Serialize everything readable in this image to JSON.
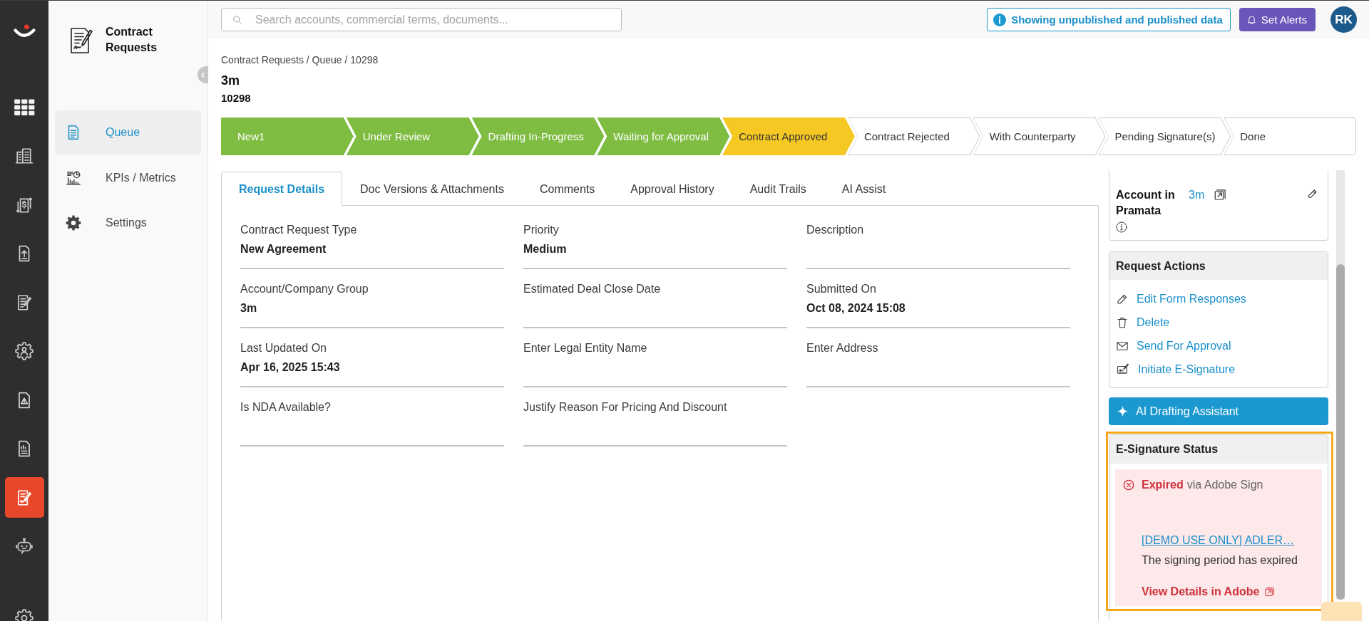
{
  "rail": {
    "items": [
      {
        "kind": "grid",
        "selected": false
      },
      {
        "kind": "buildings",
        "selected": false
      },
      {
        "kind": "dollar",
        "selected": false
      },
      {
        "kind": "upload",
        "selected": false
      },
      {
        "kind": "edit",
        "selected": false
      },
      {
        "kind": "cogperson",
        "selected": false
      },
      {
        "kind": "warning",
        "selected": false
      },
      {
        "kind": "report",
        "selected": false
      },
      {
        "kind": "signature",
        "selected": true
      },
      {
        "kind": "robot",
        "selected": false
      },
      {
        "kind": "cog",
        "selected": false
      }
    ]
  },
  "nav": {
    "title": "Contract Requests",
    "items": [
      {
        "kind": "document",
        "label": "Queue",
        "selected": true
      },
      {
        "kind": "chart",
        "label": "KPIs / Metrics",
        "selected": false
      },
      {
        "kind": "gear",
        "label": "Settings",
        "selected": false
      }
    ]
  },
  "top_bar": {
    "search": {
      "placeholder": "Search accounts, commercial terms, documents..."
    },
    "data_notice": "Showing unpublished and published data",
    "alerts_button": "Set Alerts",
    "avatar": "RK"
  },
  "header": {
    "breadcrumb": "Contract Requests / Queue / 10298",
    "title": "3m",
    "subtitle": "10298"
  },
  "stages": [
    {
      "label": "New1",
      "completed": true,
      "current": false
    },
    {
      "label": "Under Review",
      "completed": true,
      "current": false
    },
    {
      "label": "Drafting In-Progress",
      "completed": true,
      "current": false
    },
    {
      "label": "Waiting for Approval",
      "completed": true,
      "current": false
    },
    {
      "label": "Contract Approved",
      "completed": false,
      "current": true
    },
    {
      "label": "Contract Rejected",
      "completed": false,
      "current": false
    },
    {
      "label": "With Counterparty",
      "completed": false,
      "current": false
    },
    {
      "label": "Pending Signature(s)",
      "completed": false,
      "current": false
    },
    {
      "label": "Done",
      "completed": false,
      "current": false
    }
  ],
  "tabs": [
    {
      "label": "Request Details",
      "selected": true
    },
    {
      "label": "Doc Versions & Attachments",
      "selected": false
    },
    {
      "label": "Comments",
      "selected": false
    },
    {
      "label": "Approval History",
      "selected": false
    },
    {
      "label": "Audit Trails",
      "selected": false
    },
    {
      "label": "AI Assist",
      "selected": false
    }
  ],
  "fields": [
    {
      "label": "Contract Request Type",
      "value": "New Agreement"
    },
    {
      "label": "Priority",
      "value": "Medium"
    },
    {
      "label": "Description"
    },
    {
      "label": "Account/Company Group",
      "value": "3m"
    },
    {
      "label": "Estimated Deal Close Date"
    },
    {
      "label": "Submitted On",
      "value": "Oct 08, 2024 15:08"
    },
    {
      "label": "Last Updated On",
      "value": "Apr 16, 2025 15:43"
    },
    {
      "label": "Enter Legal Entity Name"
    },
    {
      "label": "Enter Address"
    },
    {
      "label": "Is NDA Available?"
    },
    {
      "label": "Justify Reason For Pricing And Discount"
    }
  ],
  "right_panel": {
    "account": {
      "label": "Account in Pramata",
      "value": "3m"
    },
    "request_actions": {
      "title": "Request Actions",
      "items": [
        {
          "kind": "edit",
          "label": "Edit Form Responses"
        },
        {
          "kind": "delete",
          "label": "Delete"
        },
        {
          "kind": "mail",
          "label": "Send For Approval"
        },
        {
          "kind": "signature",
          "label": "Initiate E-Signature"
        }
      ]
    },
    "ai_button": "AI Drafting Assistant",
    "esignature": {
      "title": "E-Signature Status",
      "expired": true,
      "status": "Expired",
      "provider": "via Adobe Sign",
      "document": "[DEMO USE ONLY] ADLER…",
      "message": "The signing period has expired",
      "details_link": "View Details in Adobe",
      "highlighted": true
    }
  }
}
